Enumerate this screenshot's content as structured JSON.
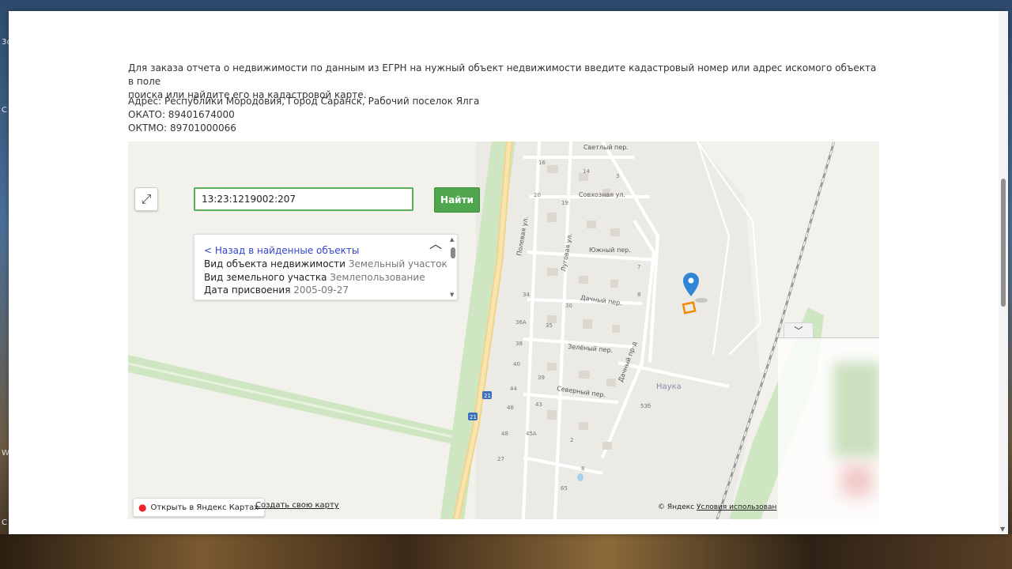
{
  "page": {
    "intro_line1": "Для заказа отчета о недвижимости по данным из ЕГРН на нужный объект недвижимости введите кадастровый номер или адрес искомого объекта в поле",
    "intro_line2": "поиска или найдите его на кадастровой карте.",
    "address": "Адрес: Республики Мородовия, Город Саранск, Рабочий поселок Ялга",
    "okato": "ОКАТО: 89401674000",
    "oktmo": "ОКТМО: 89701000066"
  },
  "search": {
    "value": "13:23:1219002:207",
    "button_label": "Найти"
  },
  "result_panel": {
    "back_link": "< Назад в найденные объекты",
    "rows": [
      {
        "label": "Вид объекта недвижимости",
        "value": "Земельный участок"
      },
      {
        "label": "Вид земельного участка",
        "value": "Землепользование"
      },
      {
        "label": "Дата присвоения",
        "value": "2005-09-27"
      }
    ]
  },
  "map": {
    "open_in_yandex": "Открыть в Яндекс Картах",
    "create_map": "Создать свою карту",
    "copyright": "© Яндекс",
    "terms": "Условия использован",
    "street_labels": [
      "Светлый пер.",
      "Совхозная ул.",
      "Полевая ул.",
      "Луговая ул.",
      "Южный пер.",
      "Дачный пер.",
      "Зелёный пер.",
      "Дачный пр-д",
      "Северный пер.",
      "Наука"
    ],
    "house_numbers": [
      "16",
      "14",
      "3",
      "20",
      "19",
      "34",
      "30",
      "36А",
      "35",
      "38",
      "40",
      "39",
      "44",
      "43",
      "46",
      "48",
      "45А",
      "2",
      "27",
      "8",
      "65",
      "53б",
      "7",
      "8"
    ],
    "road_shields": [
      "21",
      "21"
    ]
  },
  "colors": {
    "accent_green": "#4fa64f",
    "link_blue": "#3344cc",
    "marker_blue": "#2f86d6",
    "plot_orange": "#f08a00"
  },
  "desktop_labels": [
    "3c",
    "C",
    "W",
    "C"
  ]
}
